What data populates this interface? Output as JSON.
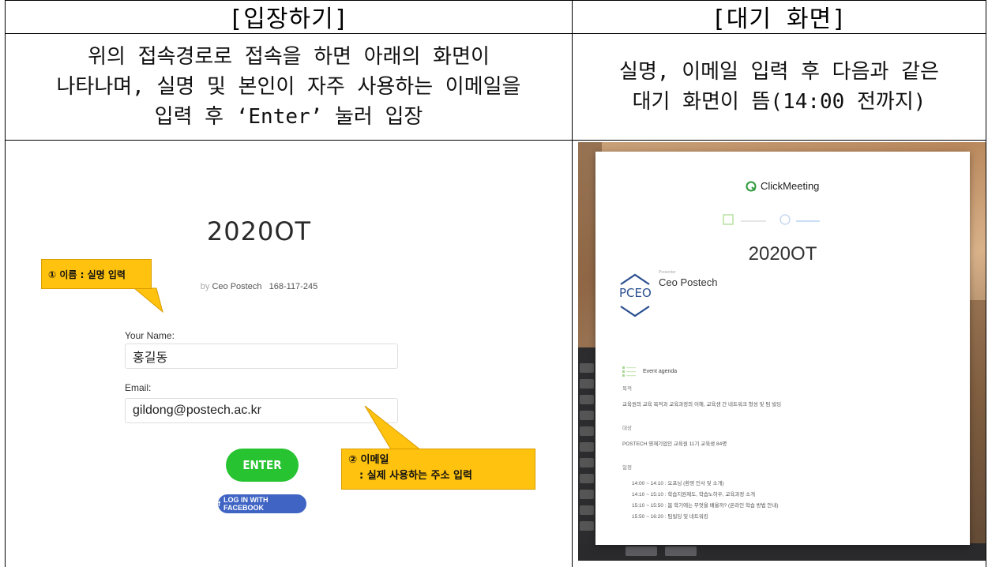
{
  "table": {
    "header_left": "[입장하기]",
    "header_right": "[대기 화면]",
    "desc_left": "위의 접속경로로 접속을 하면 아래의 화면이\n나타나며, 실명 및 본인이 자주 사용하는 이메일을\n입력 후 ‘Enter’ 눌러 입장",
    "desc_right": "실명, 이메일 입력 후 다음과 같은\n대기 화면이 뜸(14:00 전까지)"
  },
  "entry": {
    "room_title": "2020OT",
    "by_prefix": "by",
    "host": "Ceo Postech",
    "room_id": "168-117-245",
    "name_label": "Your Name:",
    "name_value": "홍길동",
    "email_label": "Email:",
    "email_value": "gildong@postech.ac.kr",
    "enter_label": "ENTER",
    "facebook_label": "LOG IN WITH FACEBOOK",
    "callout1": "① 이름 : 실명 입력",
    "callout2_line1": "② 이메일",
    "callout2_line2": ": 실제 사용하는 주소 입력",
    "colors": {
      "enter": "#27c331",
      "facebook": "#3f64c4",
      "callout": "#ffc20e"
    }
  },
  "waiting": {
    "brand": "ClickMeeting",
    "title": "2020OT",
    "presenter_caption": "Presenter",
    "presenter": "Ceo Postech",
    "logo_text": "PCEO",
    "agenda_heading": "Event agenda",
    "purpose_label": "목적",
    "purpose_text": "교육원의 교육 목적과 교육과정의 이해, 교육생 간 네트워크 형성 및 팀 빌딩",
    "target_label": "대상",
    "target_text": "POSTECH 영재기업인 교육원 11기 교육생 84명",
    "schedule_label": "일정",
    "schedule": [
      "14:00 ~ 14:10 : 오프닝 (환영 인사 및 소개)",
      "14:10 ~ 15:10 : 학습지원제도, 학습노하우, 교육과정 소개",
      "15:10 ~ 15:50 : 봄 학기에는 무엇을 배울까? (온라인 학습 방법 안내)",
      "15:50 ~ 16:20 : 팀빌딩 및 네트워킹"
    ]
  }
}
